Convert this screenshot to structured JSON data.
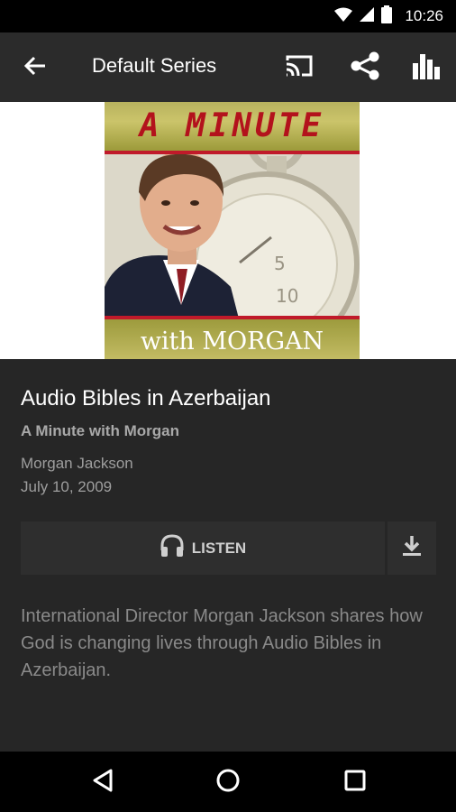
{
  "status_bar": {
    "time": "10:26"
  },
  "app_bar": {
    "title": "Default Series"
  },
  "cover": {
    "top_text": "A MINUTE",
    "bottom_text": "with MORGAN"
  },
  "episode": {
    "title": "Audio Bibles in Azerbaijan",
    "series": "A Minute with Morgan",
    "author": "Morgan Jackson",
    "date": "July 10, 2009"
  },
  "actions": {
    "listen_label": "LISTEN"
  },
  "description": "International Director Morgan Jackson shares how God is changing lives through Audio Bibles in Azerbaijan."
}
